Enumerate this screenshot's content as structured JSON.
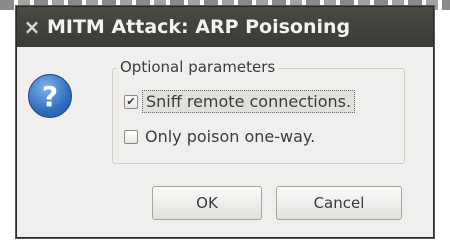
{
  "window": {
    "title": "MITM Attack: ARP Poisoning",
    "close_glyph": "×"
  },
  "icon": {
    "glyph": "?",
    "name": "question-icon"
  },
  "group": {
    "legend": "Optional parameters",
    "options": [
      {
        "label": "Sniff remote connections.",
        "checked": true,
        "focused": true
      },
      {
        "label": "Only poison one-way.",
        "checked": false,
        "focused": false
      }
    ]
  },
  "buttons": {
    "ok": "OK",
    "cancel": "Cancel"
  },
  "colors": {
    "titlebar": "#3f3f3b",
    "dialog_bg": "#f0efed",
    "icon_blue": "#2f6fbf"
  }
}
